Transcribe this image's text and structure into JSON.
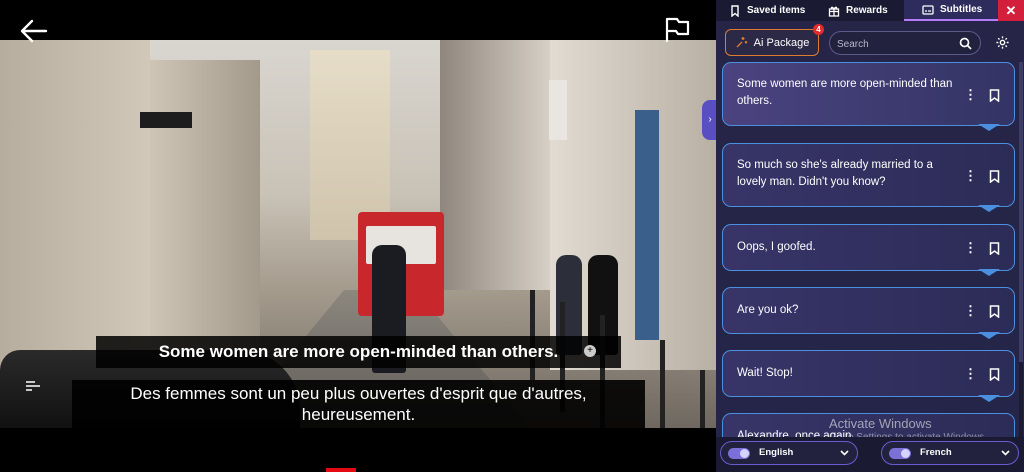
{
  "player": {
    "subtitle_primary": "Some women are more open-minded than others.",
    "subtitle_plus": "+",
    "subtitle_secondary_line1": "Des femmes sont un peu plus ouvertes d'esprit que d'autres,",
    "subtitle_secondary_line2": "heureusement.",
    "icons": [
      "back-arrow-icon",
      "flag-icon",
      "subtitle-toggle-icon"
    ]
  },
  "tabs": {
    "saved": "Saved items",
    "rewards": "Rewards",
    "subtitles": "Subtitles",
    "close": "✕"
  },
  "toolbar": {
    "ai_package": "Ai Package",
    "ai_badge": "4",
    "search_placeholder": "Search"
  },
  "subtitle_list": [
    {
      "text": "Some women are more open-minded than others."
    },
    {
      "text": "So much so she's already married to a lovely man. Didn't you know?"
    },
    {
      "text": "Oops, I goofed."
    },
    {
      "text": "Are you ok?"
    },
    {
      "text": "Wait! Stop!"
    },
    {
      "text": "Alexandre, once again..."
    }
  ],
  "languages": {
    "primary": "English",
    "secondary": "French"
  },
  "watermark": {
    "line1": "Activate Windows",
    "line2": "Go to Settings to activate Windows."
  },
  "colors": {
    "accent": "#b57dfa",
    "card_border": "#4a8fe0",
    "ai_border": "#e07b2e",
    "close": "#d41f3c"
  }
}
